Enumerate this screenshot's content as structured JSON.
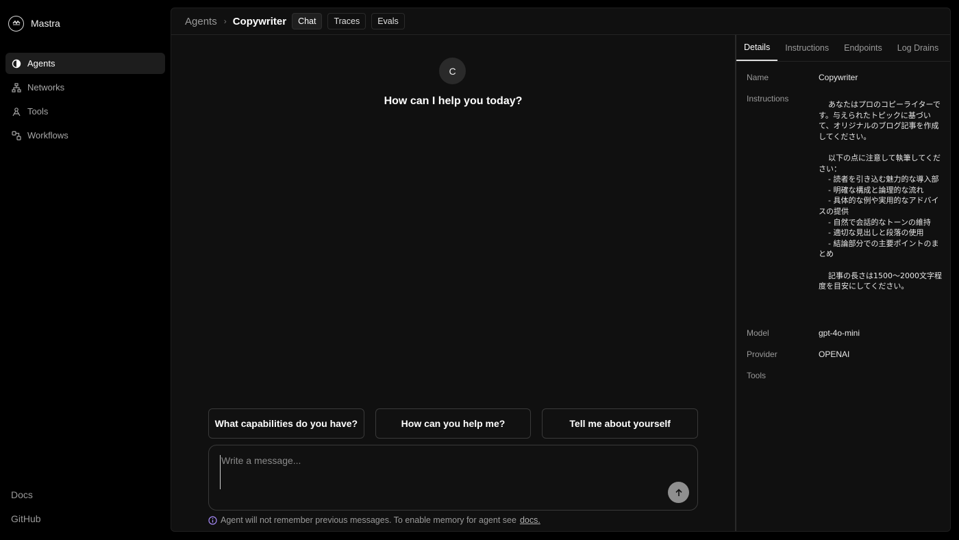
{
  "app": {
    "name": "Mastra"
  },
  "sidebar": {
    "items": [
      {
        "label": "Agents",
        "icon": "agents-icon",
        "active": true
      },
      {
        "label": "Networks",
        "icon": "networks-icon",
        "active": false
      },
      {
        "label": "Tools",
        "icon": "tools-icon",
        "active": false
      },
      {
        "label": "Workflows",
        "icon": "workflows-icon",
        "active": false
      }
    ],
    "footer": {
      "docs": "Docs",
      "github": "GitHub"
    }
  },
  "header": {
    "breadcrumb_root": "Agents",
    "breadcrumb_current": "Copywriter",
    "tabs": [
      {
        "label": "Chat",
        "active": true
      },
      {
        "label": "Traces",
        "active": false
      },
      {
        "label": "Evals",
        "active": false
      }
    ]
  },
  "chat": {
    "avatar_letter": "C",
    "greeting": "How can I help you today?",
    "suggestions": [
      "What capabilities do you have?",
      "How can you help me?",
      "Tell me about yourself"
    ],
    "input_placeholder": "Write a message...",
    "notice_text": "Agent will not remember previous messages. To enable memory for agent see",
    "notice_link": "docs."
  },
  "panel": {
    "tabs": [
      {
        "label": "Details",
        "active": true
      },
      {
        "label": "Instructions",
        "active": false
      },
      {
        "label": "Endpoints",
        "active": false
      },
      {
        "label": "Log Drains",
        "active": false
      }
    ],
    "details": {
      "name_label": "Name",
      "name_value": "Copywriter",
      "instructions_label": "Instructions",
      "instructions_value": "    あなたはプロのコピーライターです。与えられたトピックに基づいて、オリジナルのブログ記事を作成してください。\n\n    以下の点に注意して執筆してください：\n    - 読者を引き込む魅力的な導入部\n    - 明確な構成と論理的な流れ\n    - 具体的な例や実用的なアドバイスの提供\n    - 自然で会話的なトーンの維持\n    - 適切な見出しと段落の使用\n    - 結論部分での主要ポイントのまとめ\n\n    記事の長さは1500〜2000文字程度を目安にしてください。",
      "model_label": "Model",
      "model_value": "gpt-4o-mini",
      "provider_label": "Provider",
      "provider_value": "OPENAI",
      "tools_label": "Tools"
    }
  },
  "colors": {
    "background": "#000000",
    "surface": "#101010",
    "active_nav": "#1d1d1d",
    "border": "#3a3a3a",
    "info_accent": "#a78bfa"
  }
}
